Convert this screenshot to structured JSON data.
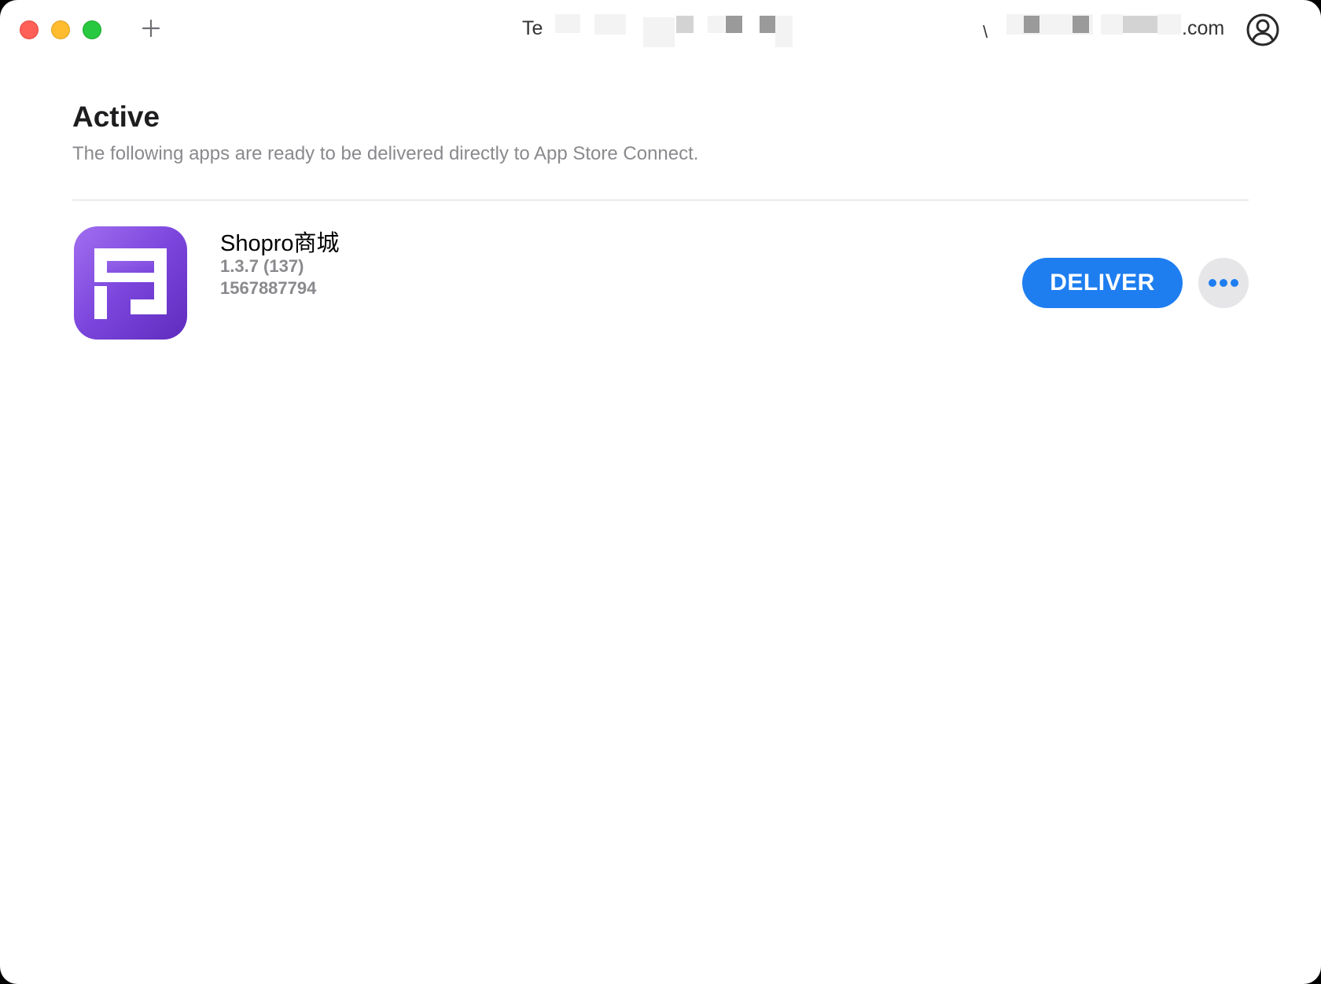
{
  "window": {
    "title_left": "Te",
    "title_right_start": "\\",
    "title_right_end": ".com"
  },
  "titlebar": {
    "close_icon": "close-dot",
    "minimize_icon": "minimize-dot",
    "maximize_icon": "maximize-dot",
    "add_icon": "plus-icon",
    "account_icon": "person-circle-icon"
  },
  "section": {
    "title": "Active",
    "subtitle": "The following apps are ready to be delivered directly to App Store Connect."
  },
  "apps": [
    {
      "name": "Shopro商城",
      "version": "1.3.7 (137)",
      "app_id": "1567887794",
      "deliver_label": "DELIVER",
      "more_icon": "ellipsis-icon"
    }
  ],
  "colors": {
    "accent": "#1e7ef0",
    "app_icon_top": "#a16ff0",
    "app_icon_bottom": "#5f2bbd"
  }
}
